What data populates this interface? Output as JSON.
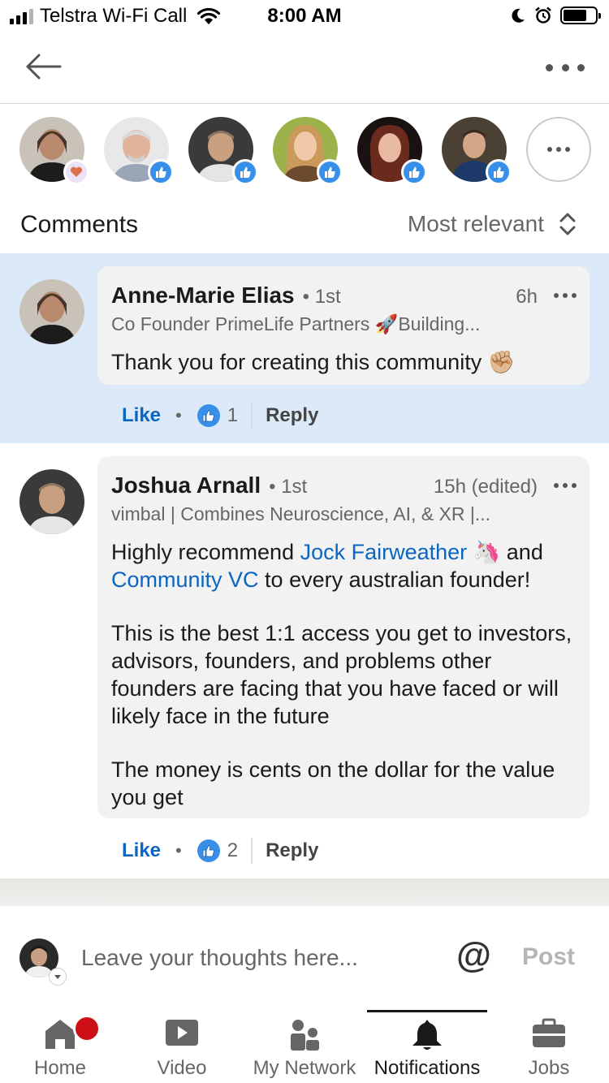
{
  "status_bar": {
    "carrier": "Telstra Wi-Fi Call",
    "time": "8:00 AM"
  },
  "reactors": [
    {
      "name": "reactor-1",
      "reaction": "love-icon"
    },
    {
      "name": "reactor-2",
      "reaction": "like-icon"
    },
    {
      "name": "reactor-3",
      "reaction": "like-icon"
    },
    {
      "name": "reactor-4",
      "reaction": "like-icon"
    },
    {
      "name": "reactor-5",
      "reaction": "like-icon"
    },
    {
      "name": "reactor-6",
      "reaction": "like-icon"
    }
  ],
  "comments_header": {
    "title": "Comments",
    "sort_label": "Most relevant"
  },
  "comments": [
    {
      "author": "Anne-Marie Elias",
      "degree": "• 1st",
      "time": "6h",
      "headline": "Co Founder PrimeLife Partners 🚀Building...",
      "text": "Thank you for creating this community ✊🏼",
      "like_label": "Like",
      "like_count": "1",
      "reply_label": "Reply"
    },
    {
      "author": "Joshua Arnall",
      "degree": "• 1st",
      "time": "15h (edited)",
      "headline": "vimbal | Combines Neuroscience, AI, & XR |...",
      "p1_a": "Highly recommend ",
      "mention1": "Jock Fairweather",
      "p1_b": " 🦄 and",
      "mention2": "Community VC",
      "p1_c": " to every australian founder!",
      "p2": "This is the best 1:1 access you get to investors, advisors, founders, and problems other founders are facing that you have faced or will likely face in the future",
      "p3": "The money is cents on the dollar for the value you get",
      "like_label": "Like",
      "like_count": "2",
      "reply_label": "Reply"
    }
  ],
  "compose": {
    "placeholder": "Leave your thoughts here...",
    "at_label": "@",
    "post_label": "Post"
  },
  "tabs": [
    {
      "label": "Home",
      "icon": "home-icon"
    },
    {
      "label": "Video",
      "icon": "video-icon"
    },
    {
      "label": "My Network",
      "icon": "network-icon"
    },
    {
      "label": "Notifications",
      "icon": "bell-icon",
      "active": true
    },
    {
      "label": "Jobs",
      "icon": "briefcase-icon"
    }
  ],
  "colors": {
    "link": "#0a66c2",
    "highlight": "#dce9f8",
    "like_badge": "#378fe9",
    "notif_badge": "#cc1016"
  }
}
